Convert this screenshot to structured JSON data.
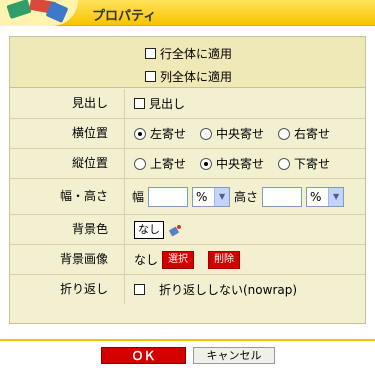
{
  "header": {
    "title": "プロパティ",
    "accent_color": "#f7c400"
  },
  "apply": {
    "row_label": "行全体に適用",
    "col_label": "列全体に適用"
  },
  "form": {
    "heading": {
      "label": "見出し",
      "checkbox_label": "見出し"
    },
    "halign": {
      "label": "横位置",
      "options": [
        "左寄せ",
        "中央寄せ",
        "右寄せ"
      ],
      "selected": "左寄せ"
    },
    "valign": {
      "label": "縦位置",
      "options": [
        "上寄せ",
        "中央寄せ",
        "下寄せ"
      ],
      "selected": "中央寄せ"
    },
    "size": {
      "label": "幅・高さ",
      "width_label": "幅",
      "height_label": "高さ",
      "width_value": "",
      "height_value": "",
      "width_unit": "%",
      "height_unit": "%"
    },
    "bgcolor": {
      "label": "背景色",
      "button_label": "なし",
      "icon": "paint-bucket-icon"
    },
    "bgimage": {
      "label": "背景画像",
      "value": "なし",
      "select_label": "選択",
      "delete_label": "削除"
    },
    "wrap": {
      "label": "折り返し",
      "checkbox_label": "折り返ししない(nowrap)"
    }
  },
  "footer": {
    "ok_label": "ＯＫ",
    "cancel_label": "キャンセル"
  }
}
